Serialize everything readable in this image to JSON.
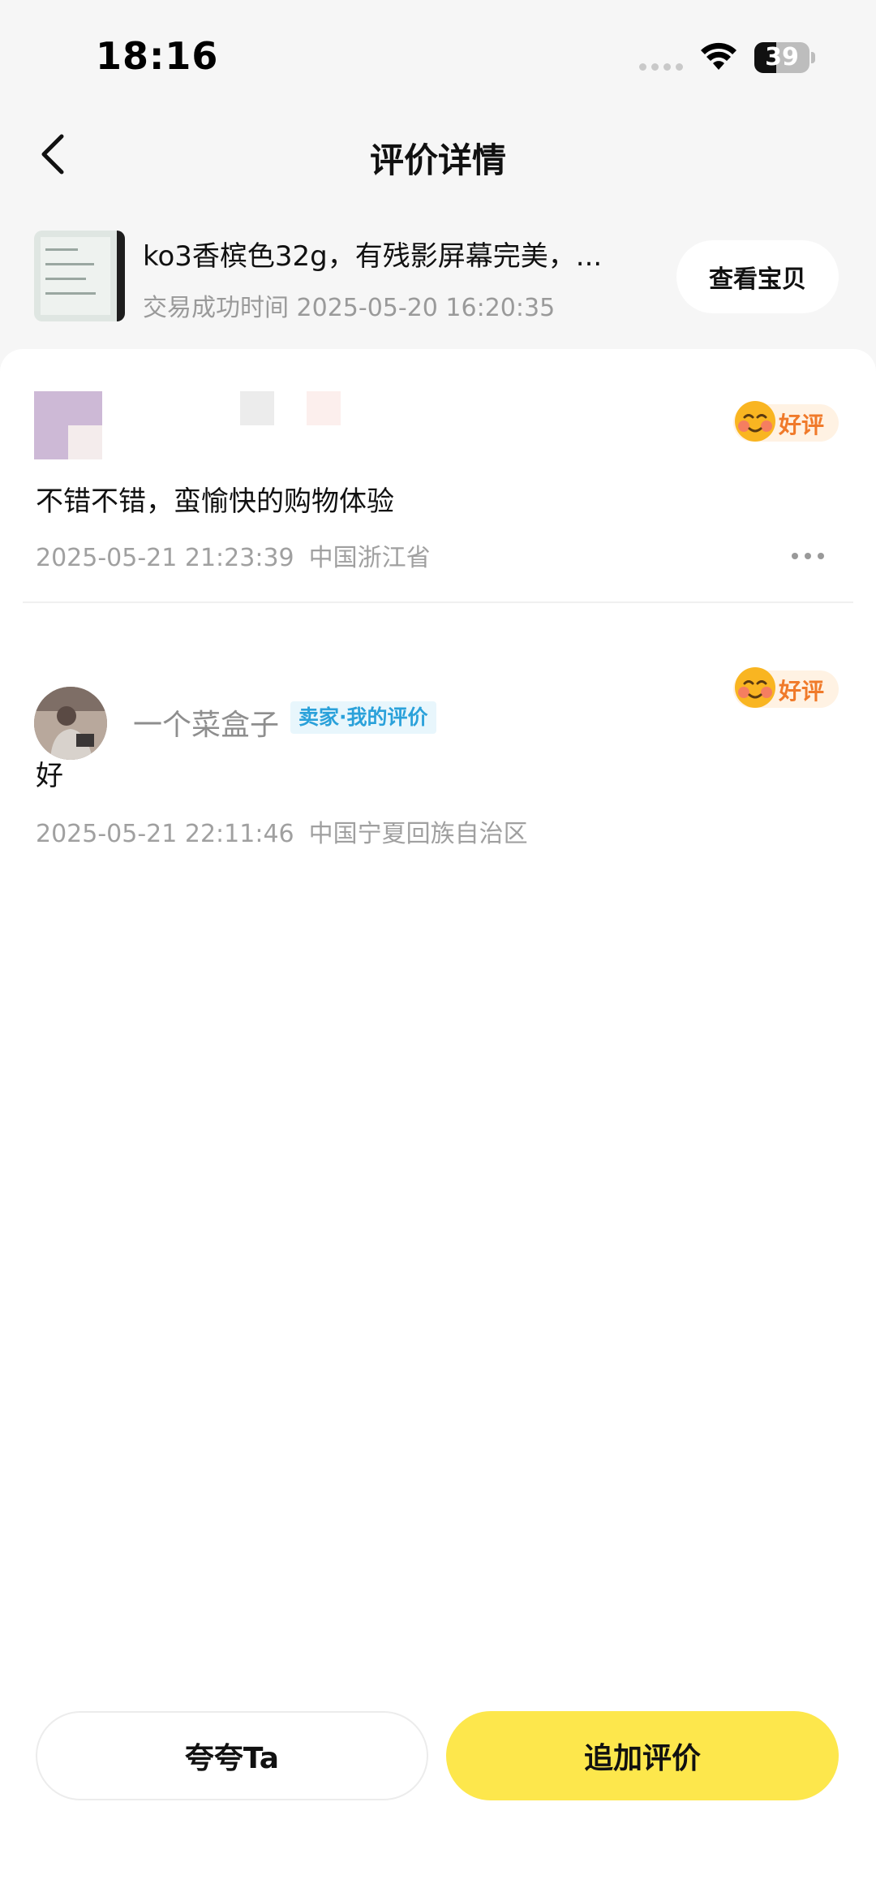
{
  "status_bar": {
    "time": "18:16",
    "battery_level": "39",
    "battery_fraction": 0.39
  },
  "header": {
    "title": "评价详情"
  },
  "product": {
    "title": "ko3香槟色32g，有残影屏幕完美，...",
    "trade_time_label": "交易成功时间",
    "trade_time": "2025-05-20 16:20:35",
    "view_button_label": "查看宝贝"
  },
  "reviews": [
    {
      "rating_label": "好评",
      "text": "不错不错，蛮愉快的购物体验",
      "date": "2025-05-21 21:23:39",
      "location": "中国浙江省"
    },
    {
      "user_name": "一个菜盒子",
      "tag": "卖家·我的评价",
      "rating_label": "好评",
      "text": "好",
      "date": "2025-05-21 22:11:46",
      "location": "中国宁夏回族自治区"
    }
  ],
  "actions": {
    "praise_label": "夸夸Ta",
    "add_review_label": "追加评价"
  },
  "colors": {
    "accent_yellow": "#fde74c",
    "rating_orange": "#f07a2a",
    "seller_tag_blue": "#2aa1da"
  },
  "icons": [
    "back-icon",
    "wifi-icon",
    "battery-icon",
    "signal-icon",
    "smile-emoji-icon",
    "more-icon"
  ]
}
